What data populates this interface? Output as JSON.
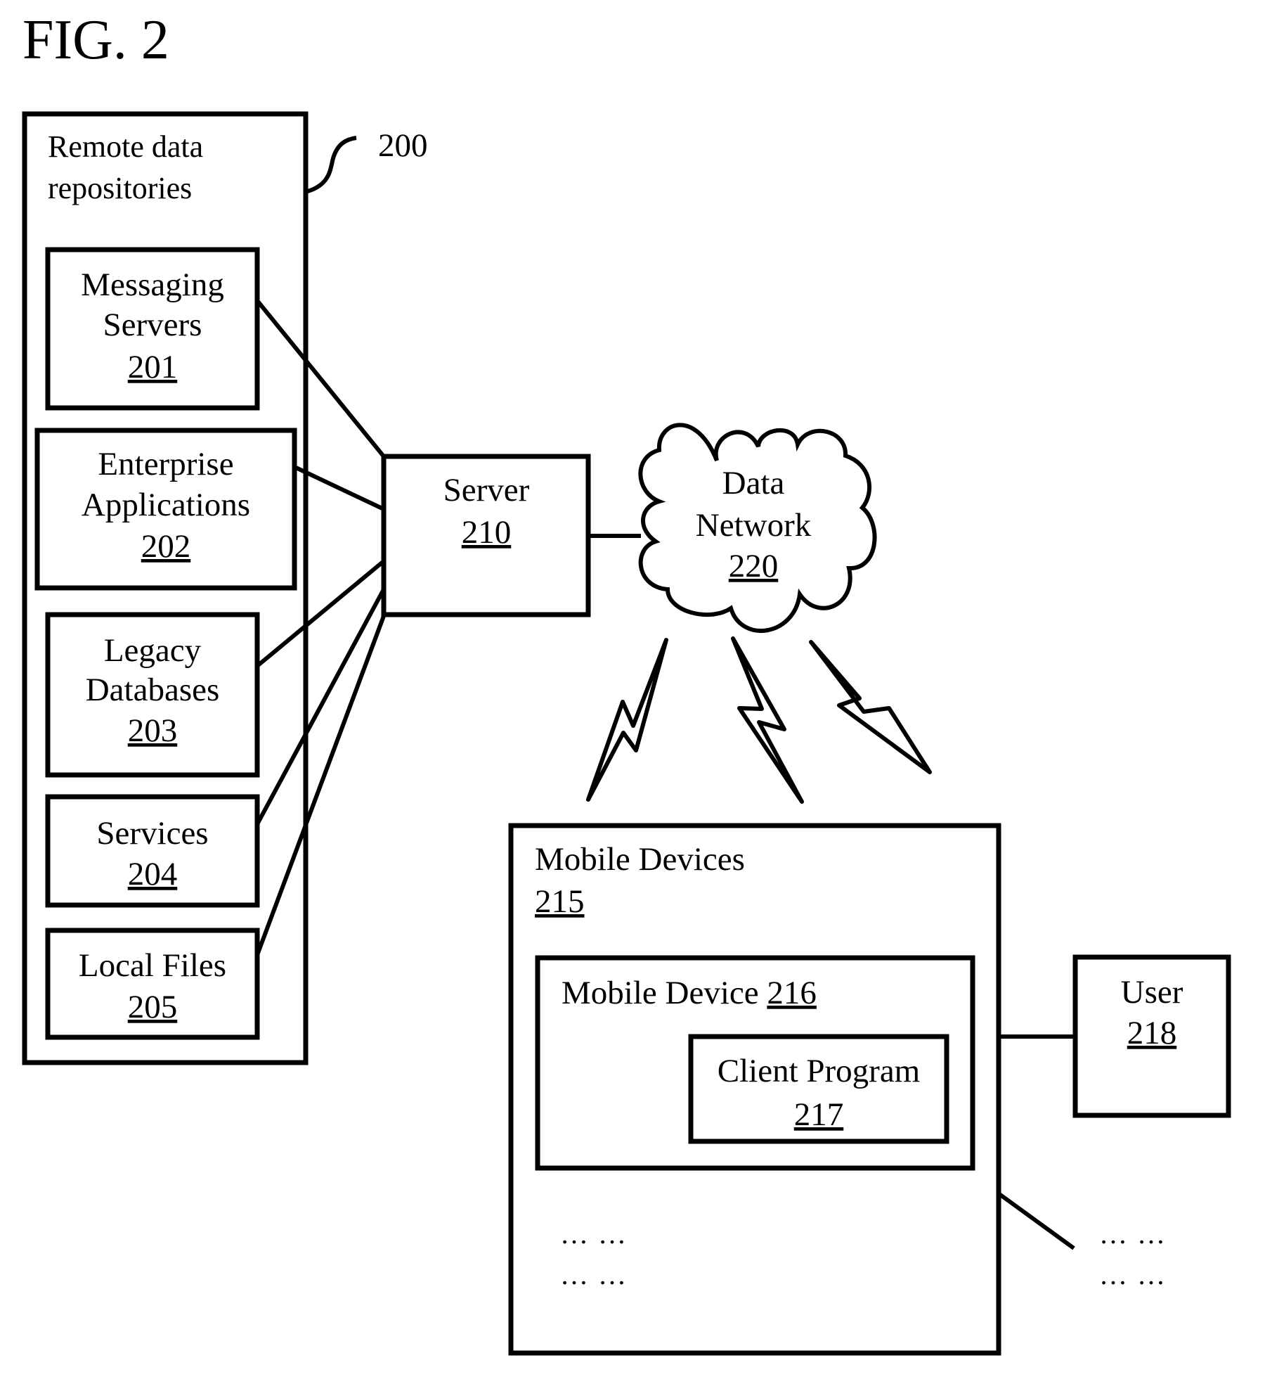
{
  "figure": {
    "title": "FIG. 2",
    "system_ref": "200"
  },
  "repositories": {
    "label_line1": "Remote data",
    "label_line2": "repositories",
    "items": [
      {
        "lines": [
          "Messaging",
          "Servers"
        ],
        "ref": "201"
      },
      {
        "lines": [
          "Enterprise",
          "Applications"
        ],
        "ref": "202"
      },
      {
        "lines": [
          "Legacy",
          "Databases"
        ],
        "ref": "203"
      },
      {
        "lines": [
          "Services"
        ],
        "ref": "204"
      },
      {
        "lines": [
          "Local Files"
        ],
        "ref": "205"
      }
    ]
  },
  "server": {
    "label": "Server",
    "ref": "210"
  },
  "network": {
    "line1": "Data",
    "line2": "Network",
    "ref": "220"
  },
  "mobile_devices": {
    "label": "Mobile Devices",
    "ref": "215",
    "device": {
      "label": "Mobile Device ",
      "ref": "216"
    },
    "client": {
      "label": "Client Program",
      "ref": "217"
    },
    "ellipsis": "… …"
  },
  "user": {
    "label": "User",
    "ref": "218"
  },
  "outside_ellipsis": "… …",
  "colors": {
    "stroke": "#000000",
    "background": "#ffffff"
  }
}
